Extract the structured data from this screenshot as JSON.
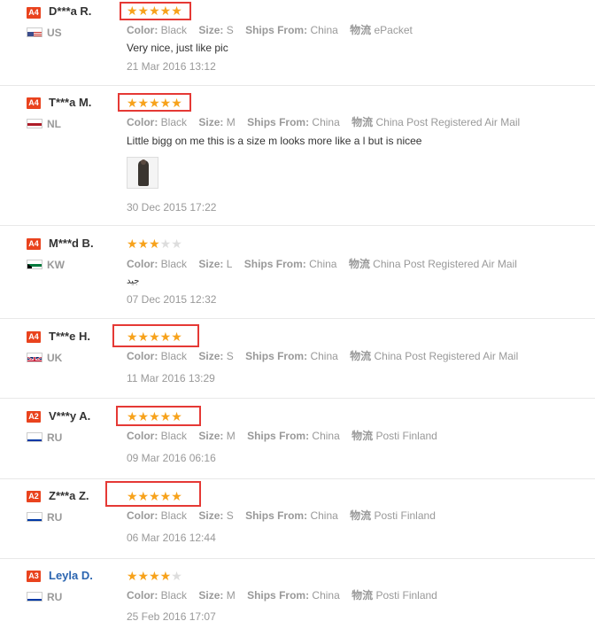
{
  "labels": {
    "color": "Color:",
    "size": "Size:",
    "ships_from": "Ships From:",
    "logistics": "物流"
  },
  "accent": {
    "star_on": "#f7a21b",
    "star_off": "#dddddd",
    "highlight": "#e53935",
    "level_badge": "#e9431e",
    "link": "#2b65b0"
  },
  "reviews": [
    {
      "level": "A4",
      "user": "D***a R.",
      "country": "US",
      "flag": "us-flag-icon",
      "rating": 5,
      "highlighted": true,
      "color": "Black",
      "size": "S",
      "ships_from": "China",
      "logistics": "ePacket",
      "text": "Very nice, just like pic",
      "date": "21 Mar 2016 13:12"
    },
    {
      "level": "A4",
      "user": "T***a M.",
      "country": "NL",
      "flag": "nl-flag-icon",
      "rating": 5,
      "highlighted": true,
      "color": "Black",
      "size": "M",
      "ships_from": "China",
      "logistics": "China Post Registered Air Mail",
      "text": "Little bigg on me this is a size m looks more like a l but is nicee",
      "has_photo": true,
      "date": "30 Dec 2015 17:22"
    },
    {
      "level": "A4",
      "user": "M***d B.",
      "country": "KW",
      "flag": "kw-flag-icon",
      "rating": 3,
      "highlighted": false,
      "color": "Black",
      "size": "L",
      "ships_from": "China",
      "logistics": "China Post Registered Air Mail",
      "text": "جيد",
      "date": "07 Dec 2015 12:32"
    },
    {
      "level": "A4",
      "user": "T***e H.",
      "country": "UK",
      "flag": "uk-flag-icon",
      "rating": 5,
      "highlighted": true,
      "color": "Black",
      "size": "S",
      "ships_from": "China",
      "logistics": "China Post Registered Air Mail",
      "date": "11 Mar 2016 13:29"
    },
    {
      "level": "A2",
      "user": "V***y A.",
      "country": "RU",
      "flag": "ru-flag-icon",
      "rating": 5,
      "highlighted": true,
      "color": "Black",
      "size": "M",
      "ships_from": "China",
      "logistics": "Posti Finland",
      "date": "09 Mar 2016 06:16"
    },
    {
      "level": "A2",
      "user": "Z***a Z.",
      "country": "RU",
      "flag": "ru-flag-icon",
      "rating": 5,
      "highlighted": true,
      "color": "Black",
      "size": "S",
      "ships_from": "China",
      "logistics": "Posti Finland",
      "date": "06 Mar 2016 12:44"
    },
    {
      "level": "A3",
      "user": "Leyla D.",
      "country": "RU",
      "flag": "ru-flag-icon",
      "rating": 4,
      "highlighted": false,
      "color": "Black",
      "size": "M",
      "ships_from": "China",
      "logistics": "Posti Finland",
      "date": "25 Feb 2016 17:07"
    }
  ]
}
